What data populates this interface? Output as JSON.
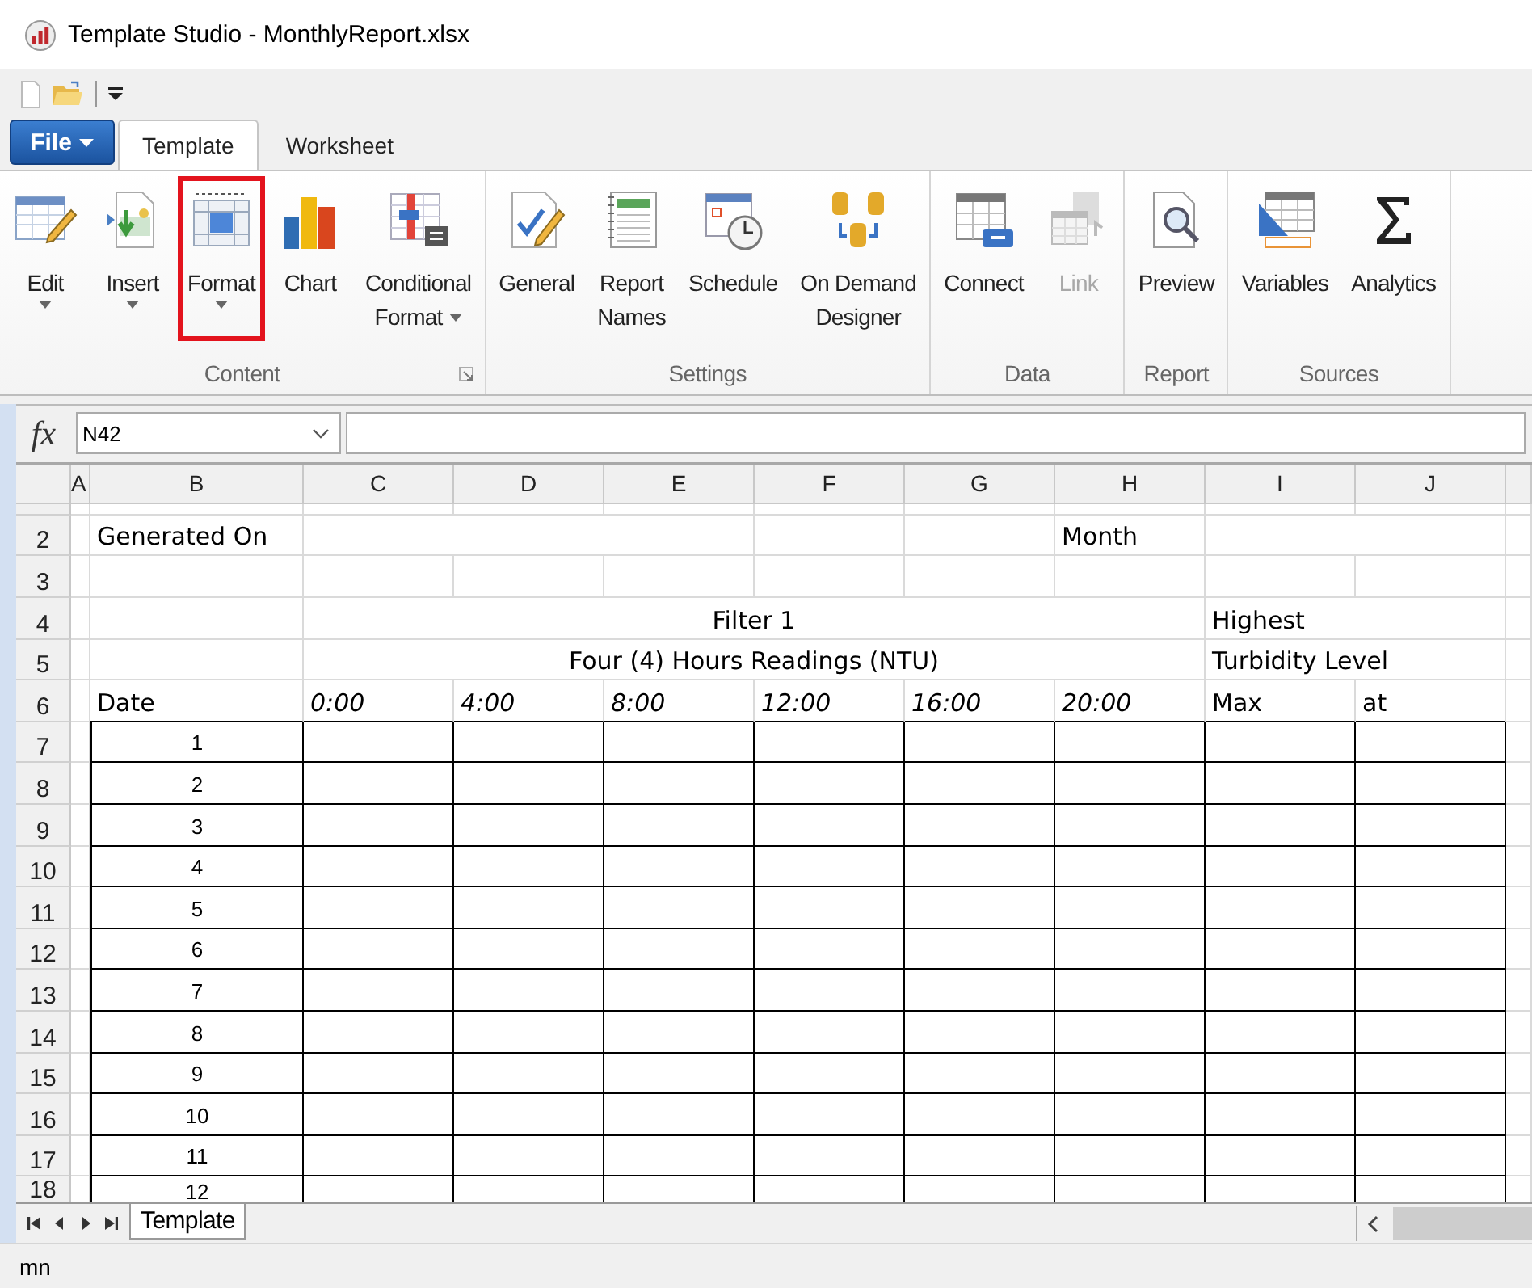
{
  "window": {
    "title": "Template Studio - MonthlyReport.xlsx"
  },
  "ribbon_tabs": [
    {
      "label": "File",
      "kind": "menu",
      "selected": false
    },
    {
      "label": "Template",
      "kind": "tab",
      "selected": true
    },
    {
      "label": "Worksheet",
      "kind": "tab",
      "selected": false
    }
  ],
  "ribbon_groups": [
    {
      "label": "Content",
      "launcher": true,
      "items": [
        {
          "lines": [
            "Edit"
          ],
          "dropdown": true,
          "highlighted": false,
          "disabled": false
        },
        {
          "lines": [
            "Insert"
          ],
          "dropdown": true,
          "highlighted": false,
          "disabled": false
        },
        {
          "lines": [
            "Format"
          ],
          "dropdown": true,
          "highlighted": true,
          "disabled": false
        },
        {
          "lines": [
            "Chart"
          ],
          "dropdown": false,
          "highlighted": false,
          "disabled": false
        },
        {
          "lines": [
            "Conditional",
            "Format"
          ],
          "dropdown": true,
          "highlighted": false,
          "disabled": false
        }
      ]
    },
    {
      "label": "Settings",
      "launcher": false,
      "items": [
        {
          "lines": [
            "General"
          ],
          "dropdown": false,
          "highlighted": false,
          "disabled": false
        },
        {
          "lines": [
            "Report",
            "Names"
          ],
          "dropdown": false,
          "highlighted": false,
          "disabled": false
        },
        {
          "lines": [
            "Schedule"
          ],
          "dropdown": false,
          "highlighted": false,
          "disabled": false
        },
        {
          "lines": [
            "On Demand",
            "Designer"
          ],
          "dropdown": false,
          "highlighted": false,
          "disabled": false
        }
      ]
    },
    {
      "label": "Data",
      "launcher": false,
      "items": [
        {
          "lines": [
            "Connect"
          ],
          "dropdown": false,
          "highlighted": false,
          "disabled": false
        },
        {
          "lines": [
            "Link"
          ],
          "dropdown": false,
          "highlighted": false,
          "disabled": true
        }
      ]
    },
    {
      "label": "Report",
      "launcher": false,
      "items": [
        {
          "lines": [
            "Preview"
          ],
          "dropdown": false,
          "highlighted": false,
          "disabled": false
        }
      ]
    },
    {
      "label": "Sources",
      "launcher": false,
      "items": [
        {
          "lines": [
            "Variables"
          ],
          "dropdown": false,
          "highlighted": false,
          "disabled": false
        },
        {
          "lines": [
            "Analytics"
          ],
          "dropdown": false,
          "highlighted": false,
          "disabled": false
        }
      ]
    }
  ],
  "formula_bar": {
    "function_label": "fx",
    "name_box": "N42"
  },
  "sheet": {
    "columns": [
      "A",
      "B",
      "C",
      "D",
      "E",
      "F",
      "G",
      "H",
      "I",
      "J"
    ],
    "rows": [
      {
        "kind": "spacer"
      },
      {
        "header": "2",
        "kind": "text",
        "cells": [
          {
            "kind": "label",
            "text": "Generated On"
          },
          {
            "kind": "blank"
          },
          {
            "kind": "merged"
          },
          {
            "kind": "merged"
          },
          {
            "kind": "blank"
          },
          {
            "kind": "blank"
          },
          {
            "kind": "label",
            "text": "Month"
          },
          {
            "kind": "blank"
          },
          {
            "kind": "merged"
          }
        ]
      },
      {
        "header": "3",
        "kind": "text",
        "cells": [
          {
            "kind": "blank"
          },
          {
            "kind": "blank"
          },
          {
            "kind": "blank"
          },
          {
            "kind": "blank"
          },
          {
            "kind": "blank"
          },
          {
            "kind": "blank"
          },
          {
            "kind": "blank"
          },
          {
            "kind": "blank"
          },
          {
            "kind": "blank"
          }
        ]
      },
      {
        "header": "4",
        "kind": "text",
        "cells": [
          {
            "kind": "blank"
          },
          {
            "kind": "title",
            "text": "Filter 1"
          },
          {
            "kind": "merged"
          },
          {
            "kind": "merged"
          },
          {
            "kind": "merged"
          },
          {
            "kind": "merged"
          },
          {
            "kind": "merged"
          },
          {
            "kind": "label",
            "text": "Highest"
          },
          {
            "kind": "merged"
          }
        ]
      },
      {
        "header": "5",
        "kind": "text",
        "cells": [
          {
            "kind": "blank"
          },
          {
            "kind": "title",
            "text": "Four (4) Hours Readings (NTU)"
          },
          {
            "kind": "merged"
          },
          {
            "kind": "merged"
          },
          {
            "kind": "merged"
          },
          {
            "kind": "merged"
          },
          {
            "kind": "merged"
          },
          {
            "kind": "label",
            "text": "Turbidity Level"
          },
          {
            "kind": "merged"
          }
        ]
      },
      {
        "header": "6",
        "kind": "text",
        "cells": [
          {
            "kind": "label",
            "text": "Date"
          },
          {
            "kind": "time",
            "text": "0:00"
          },
          {
            "kind": "time",
            "text": "4:00"
          },
          {
            "kind": "time",
            "text": "8:00"
          },
          {
            "kind": "time",
            "text": "12:00"
          },
          {
            "kind": "time",
            "text": "16:00"
          },
          {
            "kind": "time",
            "text": "20:00"
          },
          {
            "kind": "label",
            "text": "Max"
          },
          {
            "kind": "label",
            "text": "at"
          }
        ]
      },
      {
        "header": "7",
        "kind": "data",
        "day": "1"
      },
      {
        "header": "8",
        "kind": "data",
        "day": "2"
      },
      {
        "header": "9",
        "kind": "data",
        "day": "3"
      },
      {
        "header": "10",
        "kind": "data",
        "day": "4"
      },
      {
        "header": "11",
        "kind": "data",
        "day": "5"
      },
      {
        "header": "12",
        "kind": "data",
        "day": "6"
      },
      {
        "header": "13",
        "kind": "data",
        "day": "7"
      },
      {
        "header": "14",
        "kind": "data",
        "day": "8"
      },
      {
        "header": "15",
        "kind": "data",
        "day": "9"
      },
      {
        "header": "16",
        "kind": "data",
        "day": "10"
      },
      {
        "header": "17",
        "kind": "data",
        "day": "11"
      },
      {
        "header": "18",
        "kind": "data",
        "day": "12"
      }
    ]
  },
  "sheet_tabs": [
    {
      "label": "Template",
      "selected": true
    }
  ],
  "status_bar": {
    "text": "mn"
  }
}
